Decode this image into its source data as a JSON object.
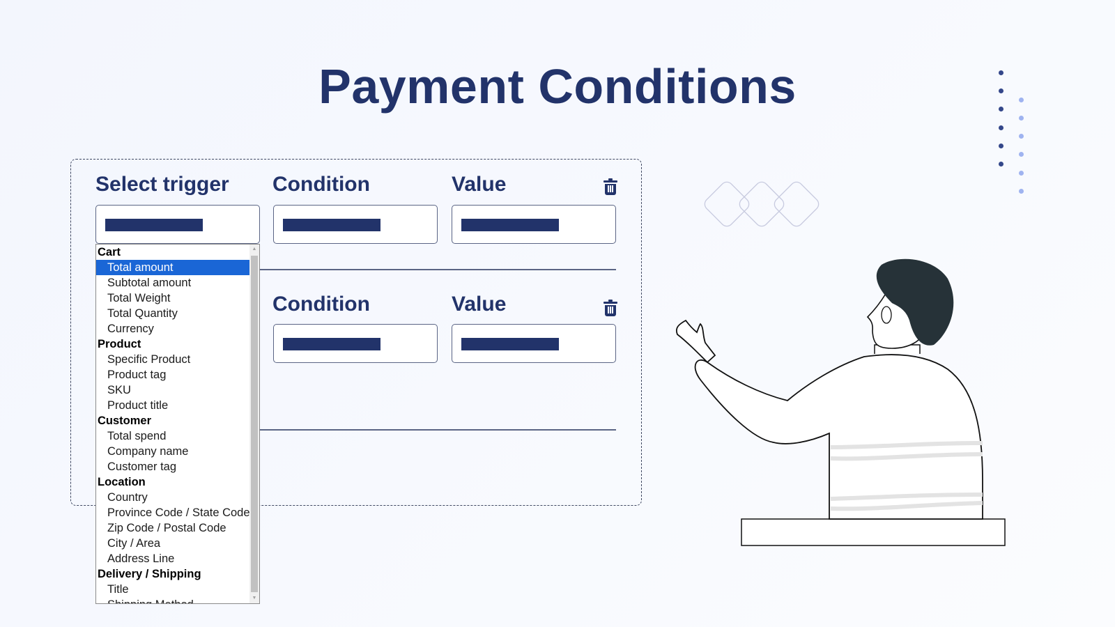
{
  "page": {
    "title": "Payment Conditions"
  },
  "rows": [
    {
      "trigger_label": "Select trigger",
      "condition_label": "Condition",
      "value_label": "Value",
      "delete_icon": "trash-icon"
    },
    {
      "condition_label": "Condition",
      "value_label": "Value",
      "delete_icon": "trash-icon"
    }
  ],
  "dropdown": {
    "selected": "Total amount",
    "groups": [
      {
        "label": "Cart",
        "options": [
          "Total amount",
          "Subtotal amount",
          "Total Weight",
          "Total Quantity",
          "Currency"
        ]
      },
      {
        "label": "Product",
        "options": [
          "Specific Product",
          "Product tag",
          "SKU",
          "Product title"
        ]
      },
      {
        "label": "Customer",
        "options": [
          "Total spend",
          "Company name",
          "Customer tag"
        ]
      },
      {
        "label": "Location",
        "options": [
          "Country",
          "Province Code / State Code",
          "Zip Code / Postal Code",
          "City / Area",
          "Address Line"
        ]
      },
      {
        "label": "Delivery / Shipping",
        "options": [
          "Title",
          "Shipping Method"
        ]
      }
    ]
  },
  "colors": {
    "brand_navy": "#22336a",
    "selection_blue": "#1a66d6",
    "dot_dark": "#34478a",
    "dot_light": "#9fb3f0",
    "hair": "#263238"
  }
}
